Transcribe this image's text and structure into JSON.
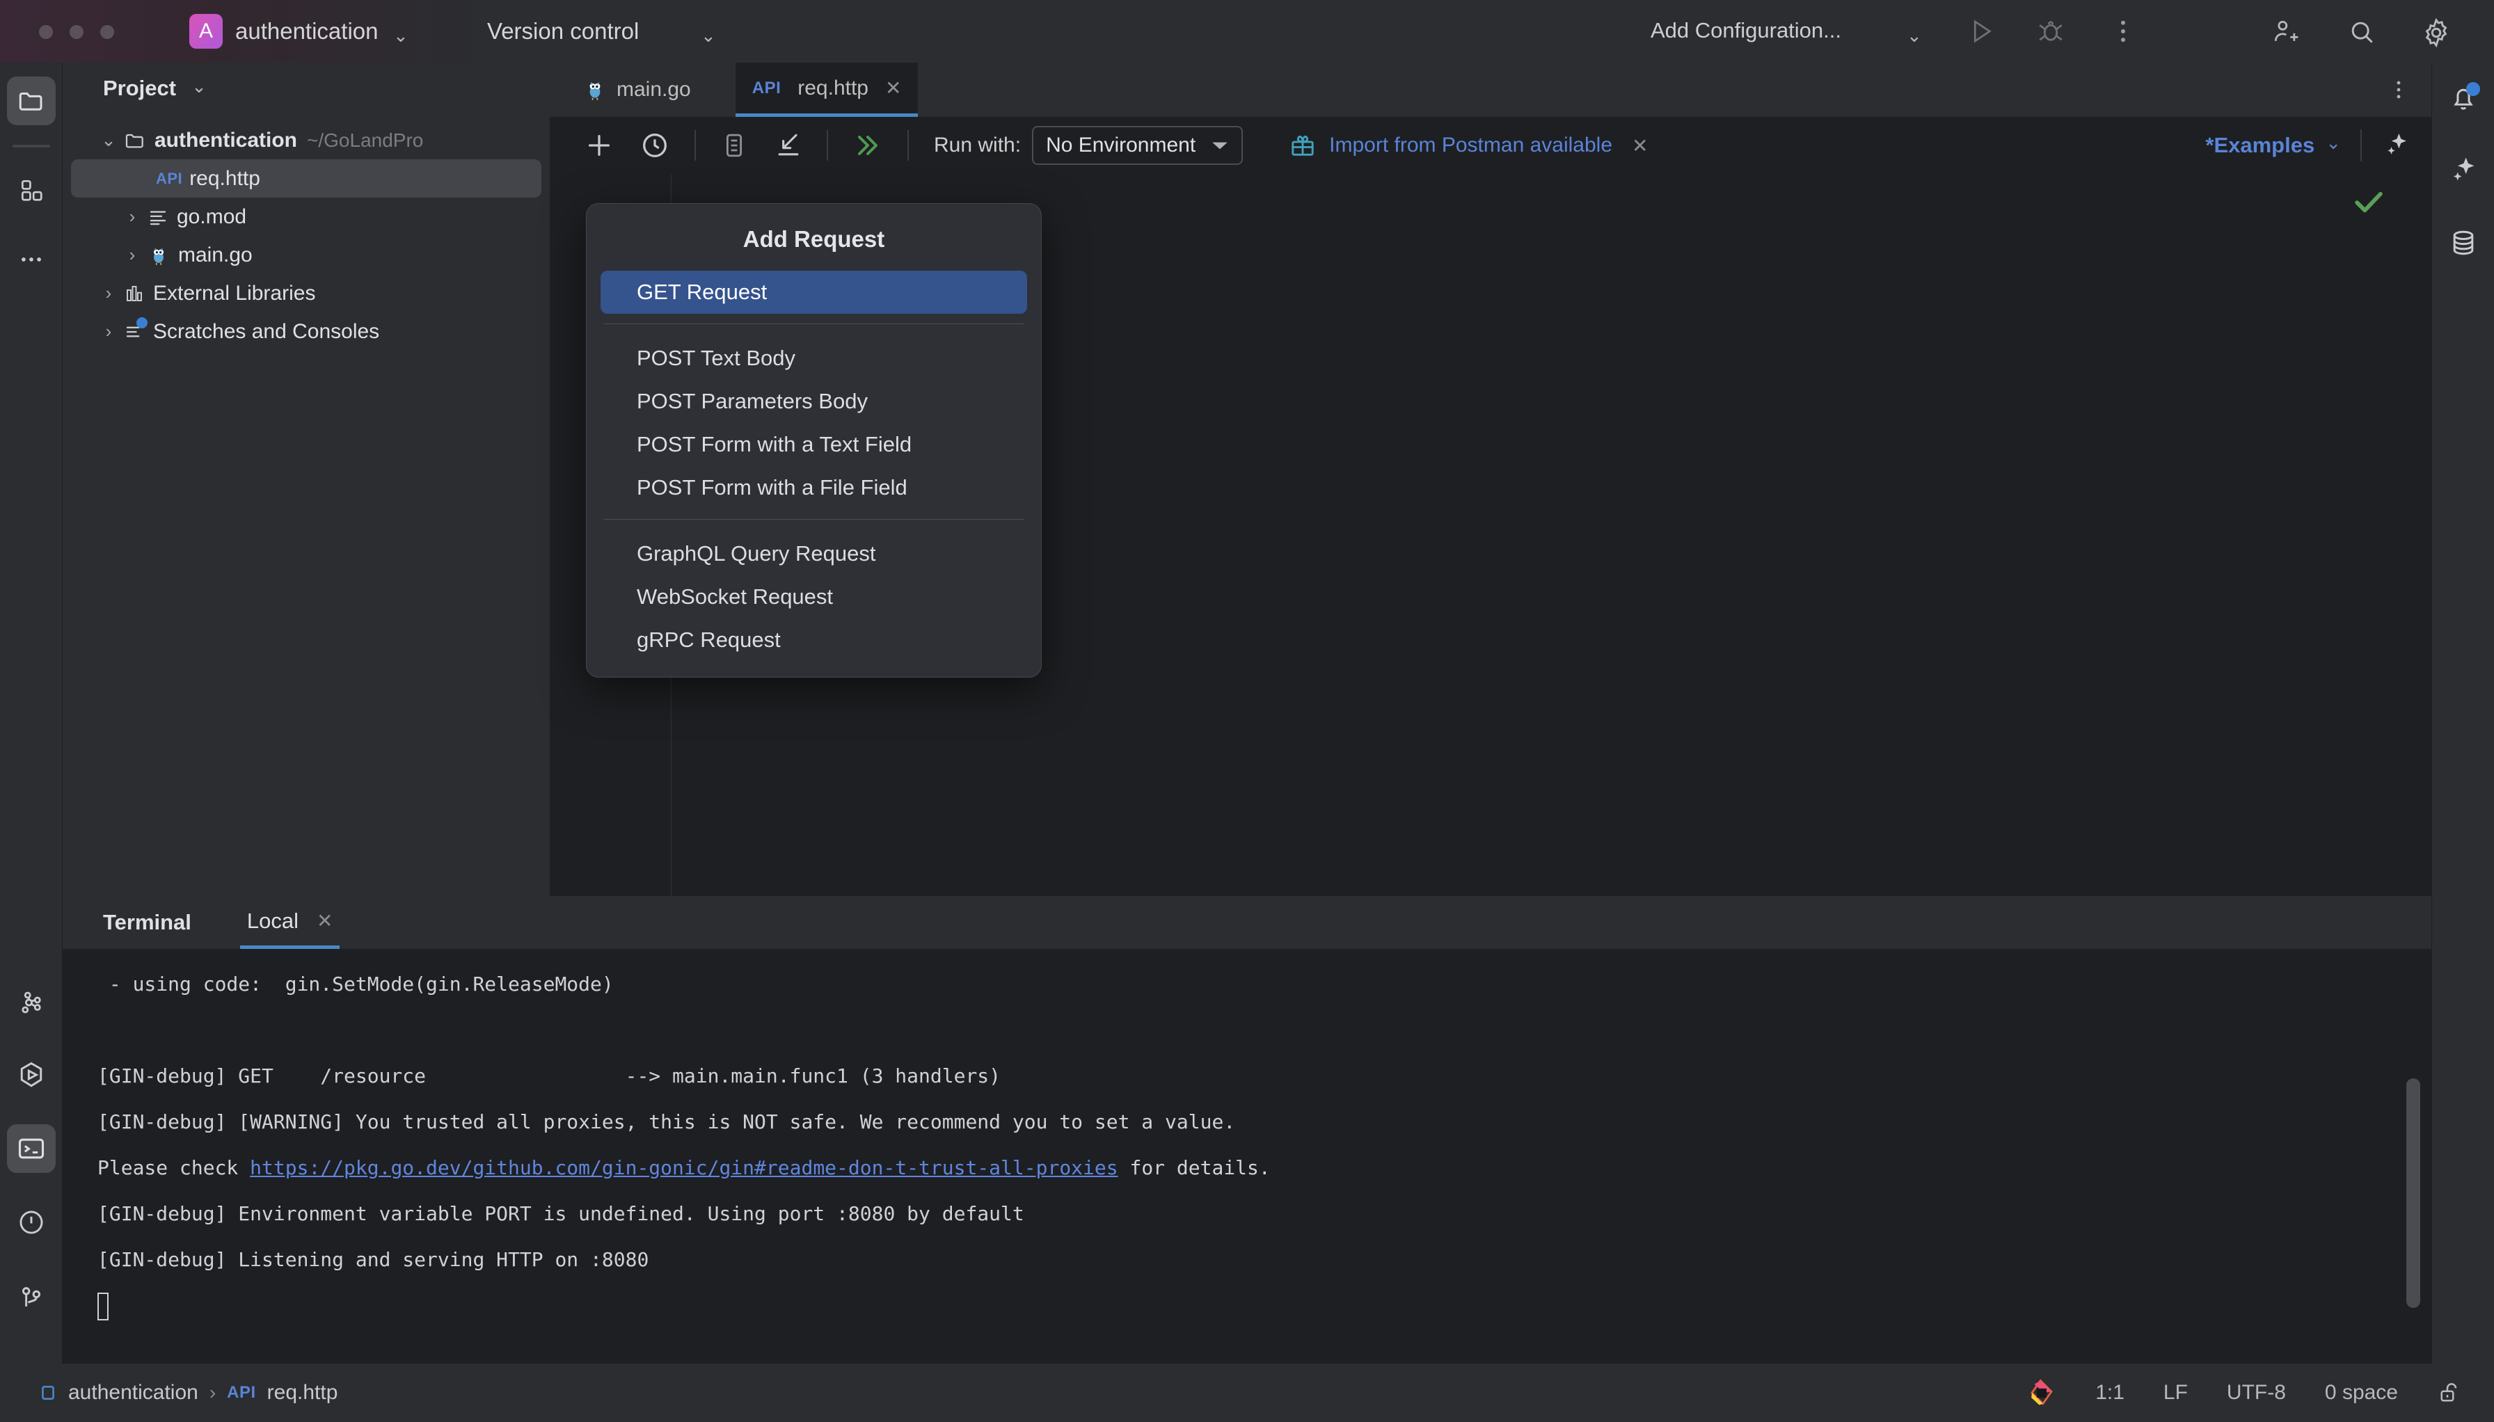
{
  "titlebar": {
    "project_initial": "A",
    "project_name": "authentication",
    "version_control": "Version control",
    "run_config": "Add Configuration...",
    "icons": [
      "run-icon",
      "debug-icon",
      "more-vertical-icon",
      "add-account-icon",
      "search-icon",
      "settings-gear-icon"
    ]
  },
  "left_rail": {
    "items": [
      {
        "name": "project-tool-window-icon",
        "active": true
      },
      {
        "name": "structure-tool-window-icon",
        "active": false
      },
      {
        "name": "more-tool-windows-icon",
        "active": false
      },
      {
        "name": "services-graph-icon",
        "active": false
      },
      {
        "name": "run-tool-window-icon",
        "active": false
      },
      {
        "name": "terminal-tool-window-icon",
        "active": true
      },
      {
        "name": "problems-tool-window-icon",
        "active": false
      },
      {
        "name": "version-control-tool-window-icon",
        "active": false
      }
    ]
  },
  "right_rail": {
    "items": [
      {
        "name": "notifications-bell-icon",
        "badge": true
      },
      {
        "name": "ai-assistant-sparkle-icon",
        "badge": false
      },
      {
        "name": "database-tool-window-icon",
        "badge": false
      }
    ]
  },
  "project_panel": {
    "title": "Project",
    "tree": [
      {
        "label": "authentication",
        "path": "~/GoLandPro",
        "icon": "folder-icon",
        "twisty": "expanded",
        "depth": 0,
        "bold": true,
        "selected": false
      },
      {
        "label": "req.http",
        "path": "",
        "icon": "api-file-icon",
        "twisty": "none",
        "depth": 1,
        "bold": false,
        "selected": true
      },
      {
        "label": "go.mod",
        "path": "",
        "icon": "gomod-file-icon",
        "twisty": "collapsed",
        "depth": 1,
        "bold": false,
        "selected": false
      },
      {
        "label": "main.go",
        "path": "",
        "icon": "go-gopher-icon",
        "twisty": "collapsed",
        "depth": 1,
        "bold": false,
        "selected": false
      },
      {
        "label": "External Libraries",
        "path": "",
        "icon": "external-libraries-icon",
        "twisty": "collapsed",
        "depth": 0,
        "bold": false,
        "selected": false
      },
      {
        "label": "Scratches and Consoles",
        "path": "",
        "icon": "scratches-icon",
        "twisty": "collapsed",
        "depth": 0,
        "bold": false,
        "selected": false
      }
    ]
  },
  "editor": {
    "tabs": [
      {
        "label": "main.go",
        "icon": "go-gopher-icon",
        "badge": "",
        "active": false,
        "closable": false
      },
      {
        "label": "req.http",
        "icon": "",
        "badge": "API",
        "active": true,
        "closable": true
      }
    ],
    "toolbar": {
      "add_label": "add-request-icon",
      "history_label": "history-clock-icon",
      "examples_icon": "examples-file-icon",
      "import_icon": "import-arrow-icon",
      "run_all_icon": "run-all-double-chevron-icon",
      "run_with_label": "Run with:",
      "environment_value": "No Environment",
      "postman_banner": "Import from Postman available",
      "postman_icon": "gift-icon",
      "examples_label": "*Examples"
    },
    "status_icon": "inspection-ok-check-icon"
  },
  "add_request_menu": {
    "title": "Add Request",
    "groups": [
      [
        {
          "label": "GET Request",
          "selected": true
        }
      ],
      [
        {
          "label": "POST Text Body",
          "selected": false
        },
        {
          "label": "POST Parameters Body",
          "selected": false
        },
        {
          "label": "POST Form with a Text Field",
          "selected": false
        },
        {
          "label": "POST Form with a File Field",
          "selected": false
        }
      ],
      [
        {
          "label": "GraphQL Query Request",
          "selected": false
        },
        {
          "label": "WebSocket Request",
          "selected": false
        },
        {
          "label": "gRPC Request",
          "selected": false
        }
      ]
    ]
  },
  "terminal": {
    "title": "Terminal",
    "tab_label": "Local",
    "lines": [
      {
        "text": " - using code:  gin.SetMode(gin.ReleaseMode)"
      },
      {
        "text": ""
      },
      {
        "text": "[GIN-debug] GET    /resource                 --> main.main.func1 (3 handlers)"
      },
      {
        "text": "[GIN-debug] [WARNING] You trusted all proxies, this is NOT safe. We recommend you to set a value."
      },
      {
        "text": "Please check ",
        "link": "https://pkg.go.dev/github.com/gin-gonic/gin#readme-don-t-trust-all-proxies",
        "after": " for details."
      },
      {
        "text": "[GIN-debug] Environment variable PORT is undefined. Using port :8080 by default"
      },
      {
        "text": "[GIN-debug] Listening and serving HTTP on :8080"
      }
    ]
  },
  "statusbar": {
    "breadcrumb_project": "authentication",
    "breadcrumb_sep": "›",
    "breadcrumb_badge": "API",
    "breadcrumb_file": "req.http",
    "caret_position": "1:1",
    "line_separator": "LF",
    "encoding": "UTF-8",
    "indent": "0 space",
    "lock_icon": "unlocked-padlock-icon",
    "jetbrains_icon": "jetbrains-ai-icon"
  },
  "colors": {
    "accent_blue": "#5a84d8",
    "selection_blue": "#35538c",
    "panel_bg": "#2b2d30",
    "editor_bg": "#1e1f22",
    "success_green": "#5a9e57"
  }
}
